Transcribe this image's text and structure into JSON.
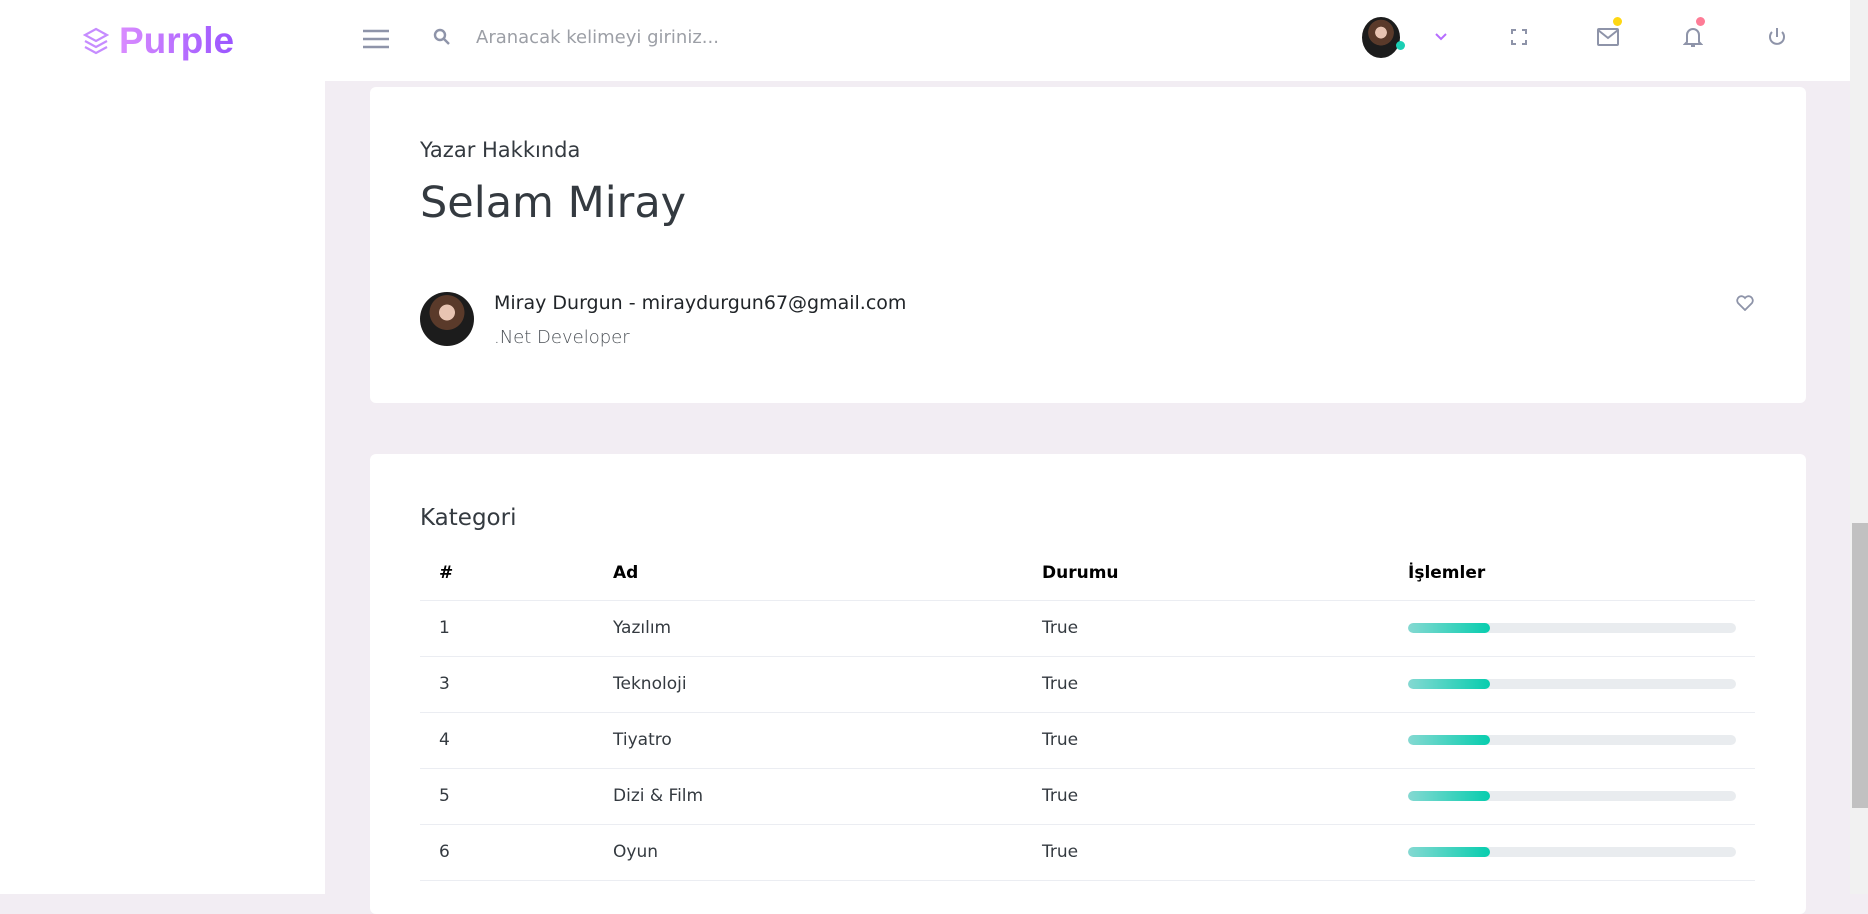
{
  "brand": {
    "name": "Purple",
    "colors": {
      "accent": "#b66dff",
      "success": "#1bcfb4",
      "warning": "#fed713",
      "danger": "#fe7c96",
      "background": "#f2edf3"
    }
  },
  "topbar": {
    "search_placeholder": "Aranacak kelimeyi giriniz...",
    "icons": [
      "menu-icon",
      "search-icon",
      "chevron-down-icon",
      "fullscreen-icon",
      "mail-icon",
      "bell-icon",
      "power-icon"
    ]
  },
  "author": {
    "section_title": "Yazar Hakkında",
    "greeting": "Selam Miray",
    "name_email": "Miray Durgun - miraydurgun67@gmail.com",
    "role": ".Net Developer"
  },
  "category": {
    "title": "Kategori",
    "columns": [
      "#",
      "Ad",
      "Durumu",
      "İşlemler"
    ],
    "rows": [
      {
        "id": "1",
        "name": "Yazılım",
        "status": "True",
        "progress": 25
      },
      {
        "id": "3",
        "name": "Teknoloji",
        "status": "True",
        "progress": 25
      },
      {
        "id": "4",
        "name": "Tiyatro",
        "status": "True",
        "progress": 25
      },
      {
        "id": "5",
        "name": "Dizi & Film",
        "status": "True",
        "progress": 25
      },
      {
        "id": "6",
        "name": "Oyun",
        "status": "True",
        "progress": 25
      }
    ]
  }
}
